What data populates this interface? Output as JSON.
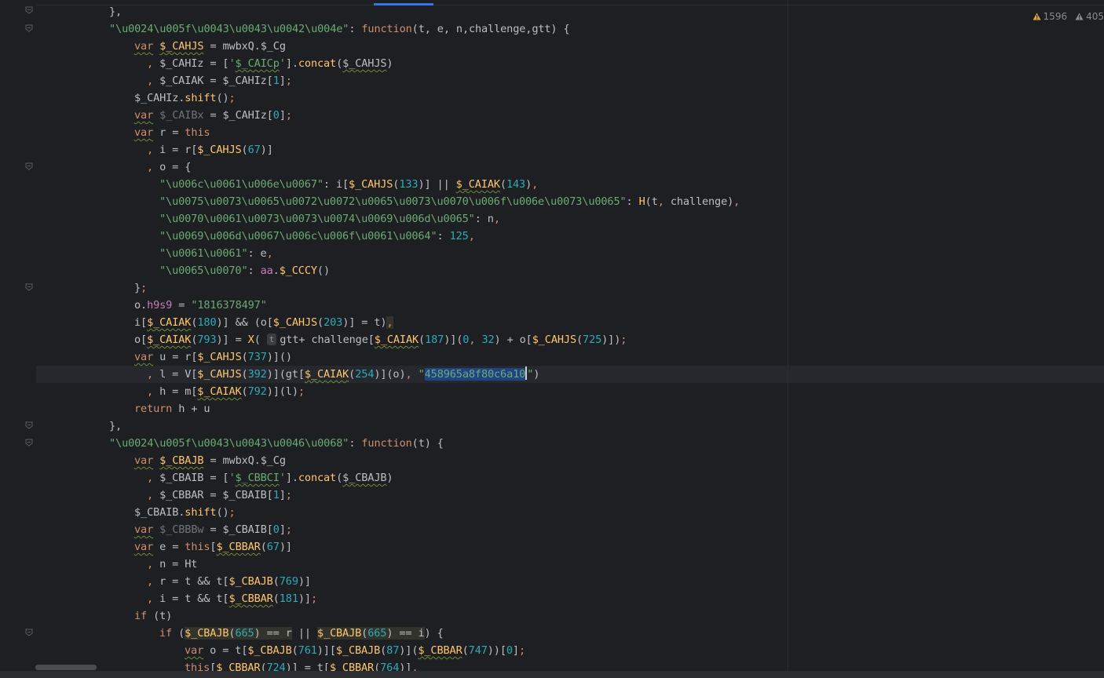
{
  "inspection": {
    "warnings": "1596",
    "weak_warnings": "405",
    "warning_icon": "warning-triangle-icon",
    "weak_warning_icon": "weak-warning-triangle-icon"
  },
  "colors": {
    "keyword": "#cf8e6d",
    "string": "#6aab73",
    "number": "#2aacb8",
    "function": "#ffc66d",
    "selection": "#214283",
    "background": "#1e1f22"
  },
  "editor": {
    "current_line": 22,
    "selected_text": "458965a8f80c6a10",
    "param_hint": "t",
    "lines": [
      "},",
      "\"\\u0024\\u005f\\u0043\\u0043\\u0042\\u004e\": function(t, e, n,challenge,gtt) {",
      "var $_CAHJS = mwbxQ.$_Cg",
      ", $_CAHIz = ['$_CAICp'].concat($_CAHJS)",
      ", $_CAIAK = $_CAHIz[1];",
      "$_CAHIz.shift();",
      "var $_CAIBx = $_CAHIz[0];",
      "var r = this",
      ", i = r[$_CAHJS(67)]",
      ", o = {",
      "\"\\u006c\\u0061\\u006e\\u0067\": i[$_CAHJS(133)] || $_CAIAK(143),",
      "\"\\u0075\\u0073\\u0065\\u0072\\u0072\\u0065\\u0073\\u0070\\u006f\\u006e\\u0073\\u0065\": H(t, challenge),",
      "\"\\u0070\\u0061\\u0073\\u0073\\u0074\\u0069\\u006d\\u0065\": n,",
      "\"\\u0069\\u006d\\u0067\\u006c\\u006f\\u0061\\u0064\": 125,",
      "\"\\u0061\\u0061\": e,",
      "\"\\u0065\\u0070\": aa.$_CCCY()",
      "};",
      "o.h9s9 = \"1816378497\"",
      "i[$_CAIAK(180)] && (o[$_CAHJS(203)] = t),",
      "o[$_CAIAK(793)] = X( t: gtt+ challenge[$_CAIAK(187)](0, 32) + o[$_CAHJS(725)]);",
      "var u = r[$_CAHJS(737)]()",
      ", l = V[$_CAHJS(392)](gt[$_CAIAK(254)](o), \"458965a8f80c6a10\")",
      ", h = m[$_CAIAK(792)](l);",
      "return h + u",
      "},",
      "\"\\u0024\\u005f\\u0043\\u0043\\u0046\\u0068\": function(t) {",
      "var $_CBAJB = mwbxQ.$_Cg",
      ", $_CBAIB = ['$_CBBCI'].concat($_CBAJB)",
      ", $_CBBAR = $_CBAIB[1];",
      "$_CBAIB.shift();",
      "var $_CBBBw = $_CBAIB[0];",
      "var e = this[$_CBBAR(67)]",
      ", n = Ht",
      ", r = t && t[$_CBAJB(769)]",
      ", i = t && t[$_CBBAR(181)];",
      "if (t)",
      "if ($_CBAJB(665) == r || $_CBAJB(665) == i) {",
      "var o = t[$_CBAJB(761)][$_CBAJB(87)]($_CBBAR(747))[0];",
      "this[$_CBBAR(724)] = t[$_CBBAR(764)],"
    ]
  }
}
